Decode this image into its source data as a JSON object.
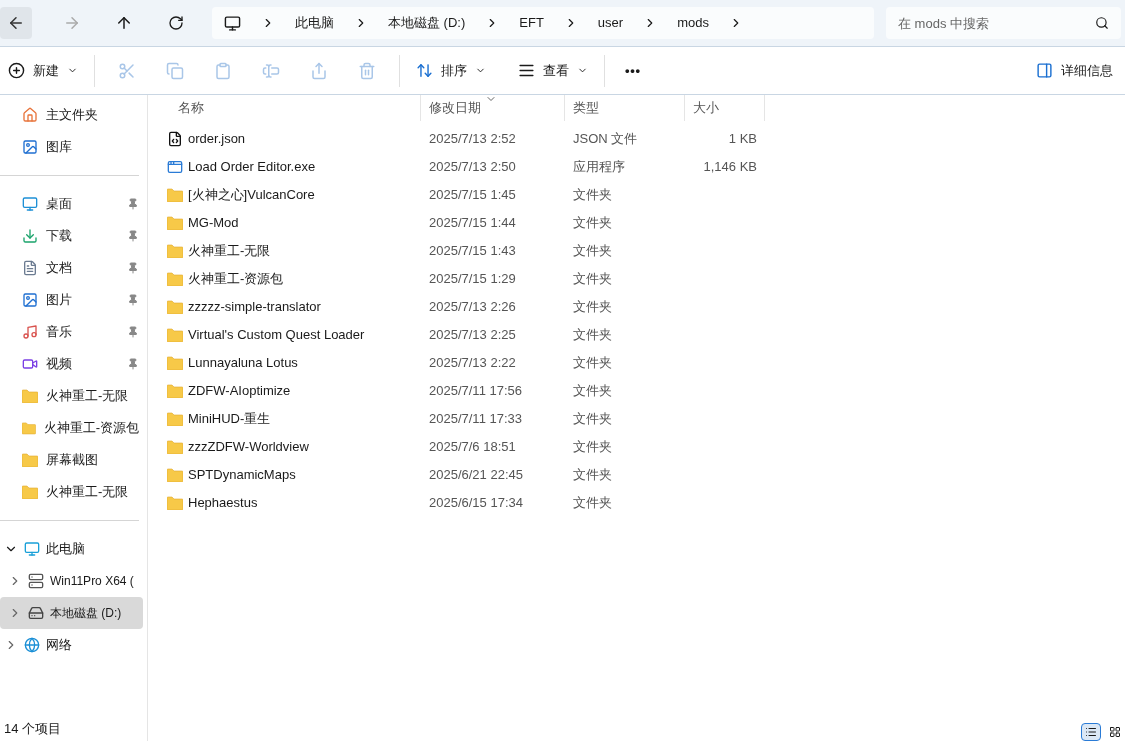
{
  "nav": {
    "back_disabled": false,
    "forward_disabled": true
  },
  "breadcrumb": [
    "此电脑",
    "本地磁盘 (D:)",
    "EFT",
    "user",
    "mods"
  ],
  "search": {
    "placeholder": "在 mods 中搜索"
  },
  "toolbar": {
    "new": "新建",
    "actions": [
      {
        "kind": "cut",
        "disabled": true
      },
      {
        "kind": "copy",
        "disabled": true
      },
      {
        "kind": "paste",
        "disabled": true
      },
      {
        "kind": "rename",
        "disabled": true
      },
      {
        "kind": "share",
        "disabled": true
      },
      {
        "kind": "delete",
        "disabled": true
      }
    ],
    "sort": "排序",
    "view": "查看",
    "more": "•••",
    "details": "详细信息"
  },
  "sidebar": {
    "top": [
      {
        "kind": "home",
        "label": "主文件夹"
      },
      {
        "kind": "gallery",
        "label": "图库"
      }
    ],
    "quick": [
      {
        "kind": "desktop",
        "label": "桌面",
        "pinned": true
      },
      {
        "kind": "download",
        "label": "下载",
        "pinned": true
      },
      {
        "kind": "document",
        "label": "文档",
        "pinned": true
      },
      {
        "kind": "picture",
        "label": "图片",
        "pinned": true
      },
      {
        "kind": "music",
        "label": "音乐",
        "pinned": true
      },
      {
        "kind": "video",
        "label": "视频",
        "pinned": true
      },
      {
        "kind": "folder",
        "label": "火神重工-无限",
        "pinned": false
      },
      {
        "kind": "folder",
        "label": "火神重工-资源包",
        "pinned": false
      },
      {
        "kind": "folder",
        "label": "屏幕截图",
        "pinned": false
      },
      {
        "kind": "folder",
        "label": "火神重工-无限",
        "pinned": false
      }
    ],
    "tree": [
      {
        "kind": "pc",
        "label": "此电脑",
        "expanded": true,
        "selected": false,
        "children": [
          {
            "kind": "system-drive",
            "label": "Win11Pro X64 (",
            "expanded": false,
            "selected": false
          },
          {
            "kind": "drive",
            "label": "本地磁盘 (D:)",
            "expanded": false,
            "selected": true
          }
        ]
      },
      {
        "kind": "network",
        "label": "网络",
        "expanded": false,
        "selected": false
      }
    ]
  },
  "table": {
    "columns": [
      {
        "label": "名称",
        "sorted": false
      },
      {
        "label": "修改日期",
        "sorted": true
      },
      {
        "label": "类型",
        "sorted": false
      },
      {
        "label": "大小",
        "sorted": false
      }
    ],
    "rows": [
      {
        "kind": "json",
        "name": "order.json",
        "date": "2025/7/13 2:52",
        "type": "JSON 文件",
        "size": "1 KB"
      },
      {
        "kind": "exe",
        "name": "Load Order Editor.exe",
        "date": "2025/7/13 2:50",
        "type": "应用程序",
        "size": "1,146 KB"
      },
      {
        "kind": "folder",
        "name": "[火神之心]VulcanCore",
        "date": "2025/7/15 1:45",
        "type": "文件夹"
      },
      {
        "kind": "folder",
        "name": "MG-Mod",
        "date": "2025/7/15 1:44",
        "type": "文件夹"
      },
      {
        "kind": "folder",
        "name": "火神重工-无限",
        "date": "2025/7/15 1:43",
        "type": "文件夹"
      },
      {
        "kind": "folder",
        "name": "火神重工-资源包",
        "date": "2025/7/15 1:29",
        "type": "文件夹"
      },
      {
        "kind": "folder",
        "name": "zzzzz-simple-translator",
        "date": "2025/7/13 2:26",
        "type": "文件夹"
      },
      {
        "kind": "folder",
        "name": "Virtual's Custom Quest Loader",
        "date": "2025/7/13 2:25",
        "type": "文件夹"
      },
      {
        "kind": "folder",
        "name": "Lunnayaluna Lotus",
        "date": "2025/7/13 2:22",
        "type": "文件夹"
      },
      {
        "kind": "folder",
        "name": "ZDFW-AIoptimize",
        "date": "2025/7/11 17:56",
        "type": "文件夹"
      },
      {
        "kind": "folder",
        "name": "MiniHUD-重生",
        "date": "2025/7/11 17:33",
        "type": "文件夹"
      },
      {
        "kind": "folder",
        "name": "zzzZDFW-Worldview",
        "date": "2025/7/6 18:51",
        "type": "文件夹"
      },
      {
        "kind": "folder",
        "name": "SPTDynamicMaps",
        "date": "2025/6/21 22:45",
        "type": "文件夹"
      },
      {
        "kind": "folder",
        "name": "Hephaestus",
        "date": "2025/6/15 17:34",
        "type": "文件夹"
      }
    ]
  },
  "status_bar": {
    "count": "14 个项目",
    "views": [
      {
        "kind": "details",
        "selected": true
      },
      {
        "kind": "tiles",
        "selected": false
      }
    ]
  }
}
